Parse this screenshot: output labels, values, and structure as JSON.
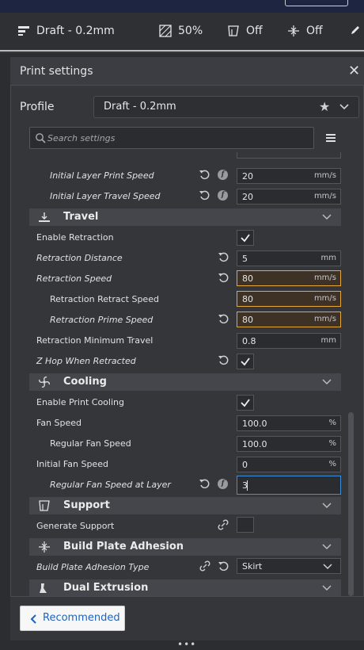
{
  "header": {
    "profile": "Draft - 0.2mm",
    "infill": "50%",
    "support": "Off",
    "adhesion": "Off"
  },
  "panel": {
    "title": "Print settings",
    "close_glyph": "✕",
    "profile_label": "Profile",
    "profile_value": "Draft - 0.2mm",
    "search_placeholder": "Search settings"
  },
  "rows": {
    "initial_layer_print_speed": {
      "label": "Initial Layer Print Speed",
      "value": "20",
      "unit": "mm/s"
    },
    "initial_layer_travel_speed": {
      "label": "Initial Layer Travel Speed",
      "value": "20",
      "unit": "mm/s"
    },
    "travel_category": "Travel",
    "enable_retraction": {
      "label": "Enable Retraction",
      "checked": true
    },
    "retraction_distance": {
      "label": "Retraction Distance",
      "value": "5",
      "unit": "mm"
    },
    "retraction_speed": {
      "label": "Retraction Speed",
      "value": "80",
      "unit": "mm/s"
    },
    "retraction_retract_speed": {
      "label": "Retraction Retract Speed",
      "value": "80",
      "unit": "mm/s"
    },
    "retraction_prime_speed": {
      "label": "Retraction Prime Speed",
      "value": "80",
      "unit": "mm/s"
    },
    "retraction_min_travel": {
      "label": "Retraction Minimum Travel",
      "value": "0.8",
      "unit": "mm"
    },
    "z_hop": {
      "label": "Z Hop When Retracted",
      "checked": true
    },
    "cooling_category": "Cooling",
    "enable_print_cooling": {
      "label": "Enable Print Cooling",
      "checked": true
    },
    "fan_speed": {
      "label": "Fan Speed",
      "value": "100.0",
      "unit": "%"
    },
    "regular_fan_speed": {
      "label": "Regular Fan Speed",
      "value": "100.0",
      "unit": "%"
    },
    "initial_fan_speed": {
      "label": "Initial Fan Speed",
      "value": "0",
      "unit": "%"
    },
    "regular_fan_speed_layer": {
      "label": "Regular Fan Speed at Layer",
      "value": "3"
    },
    "support_category": "Support",
    "generate_support": {
      "label": "Generate Support",
      "checked": false
    },
    "adhesion_category": "Build Plate Adhesion",
    "adhesion_type": {
      "label": "Build Plate Adhesion Type",
      "value": "Skirt"
    },
    "dual_category": "Dual Extrusion"
  },
  "footer": {
    "recommended_label": "Recommended",
    "drag_handle": "•••"
  },
  "colors": {
    "accent_blue": "#3d8edb",
    "warning_orange": "#e7a73a",
    "link_blue": "#1d63c0"
  }
}
